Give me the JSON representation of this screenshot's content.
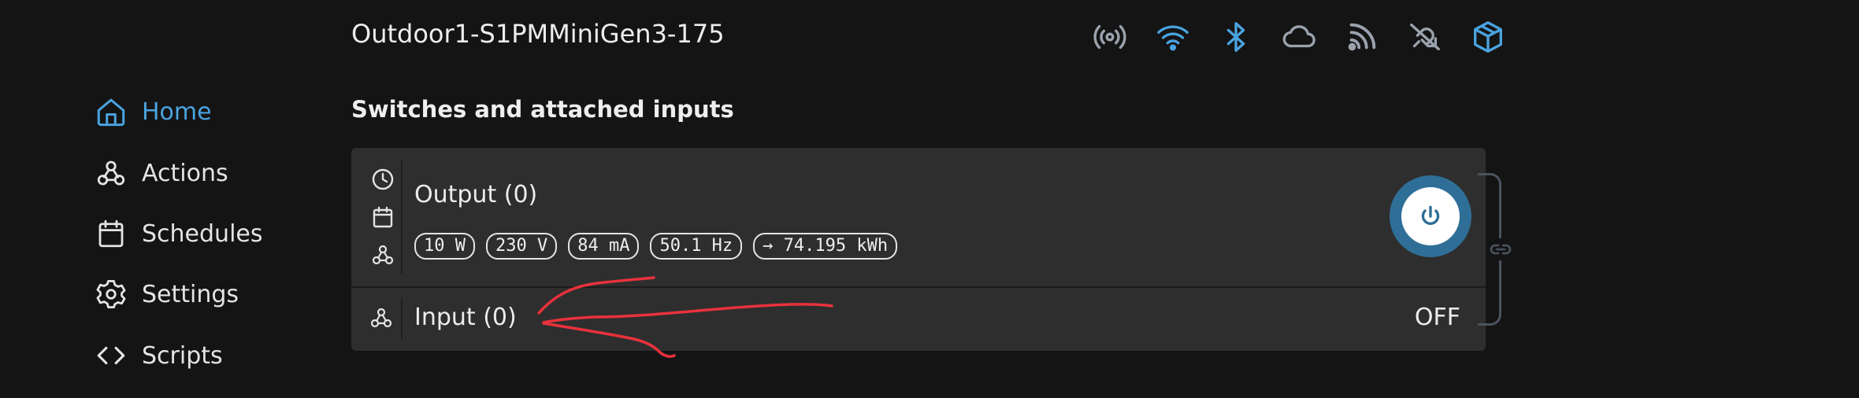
{
  "device": {
    "title": "Outdoor1-S1PMMiniGen3-175"
  },
  "status_icons": [
    {
      "icon": "antenna-icon",
      "color": "#9aa3ad"
    },
    {
      "icon": "wifi-icon",
      "color": "#4aa3df"
    },
    {
      "icon": "bluetooth-icon",
      "color": "#4aa3df"
    },
    {
      "icon": "cloud-icon",
      "color": "#9aa3ad"
    },
    {
      "icon": "rss-icon",
      "color": "#9aa3ad"
    },
    {
      "icon": "mqtt-off-icon",
      "color": "#9aa3ad"
    },
    {
      "icon": "cube-icon",
      "color": "#4aa3df"
    }
  ],
  "sidebar": {
    "items": [
      {
        "label": "Home",
        "icon": "home-icon",
        "active": true
      },
      {
        "label": "Actions",
        "icon": "webhook-icon",
        "active": false
      },
      {
        "label": "Schedules",
        "icon": "calendar-icon",
        "active": false
      },
      {
        "label": "Settings",
        "icon": "gear-icon",
        "active": false
      },
      {
        "label": "Scripts",
        "icon": "code-icon",
        "active": false
      }
    ]
  },
  "section": {
    "title": "Switches and attached inputs"
  },
  "output": {
    "name": "Output (0)",
    "power": "10 W",
    "voltage": "230 V",
    "current": "84 mA",
    "frequency": "50.1 Hz",
    "energy": "→ 74.195 kWh"
  },
  "input": {
    "name": "Input (0)",
    "state": "OFF"
  },
  "colors": {
    "accent": "#4aa3df",
    "power_ring": "#2f6f97",
    "annotation": "#e8323c"
  }
}
